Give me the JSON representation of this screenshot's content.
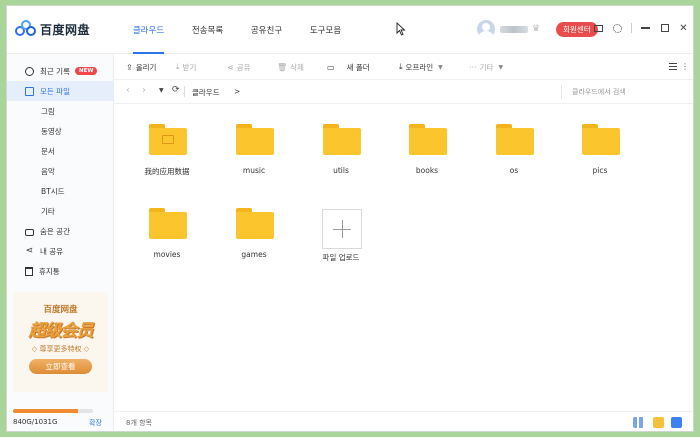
{
  "app": {
    "name": "百度网盘",
    "tabs": [
      "클라우드",
      "전송목록",
      "공유친구",
      "도구모음"
    ],
    "vip_label": "회원센터"
  },
  "sidebar": {
    "items": [
      {
        "label": "최근 기록",
        "icon": "clock-icon",
        "badge": "NEW"
      },
      {
        "label": "모든 파일",
        "icon": "file-icon"
      },
      {
        "label": "그림"
      },
      {
        "label": "동영상"
      },
      {
        "label": "문서"
      },
      {
        "label": "음악"
      },
      {
        "label": "BT시드"
      },
      {
        "label": "기타"
      },
      {
        "label": "숨은 공간",
        "icon": "lock-icon"
      },
      {
        "label": "내 공유",
        "icon": "share-icon"
      },
      {
        "label": "휴지통",
        "icon": "trash-icon"
      }
    ],
    "promo": {
      "brand": "百度网盘",
      "title": "超级会员",
      "subtitle": "◇ 尊享更多特权 ◇",
      "button": "立即查看"
    },
    "storage": {
      "used_text": "840G/1031G",
      "fraction": 0.815,
      "expand_label": "확장"
    }
  },
  "toolbar": {
    "upload": "올리기",
    "download": "받기",
    "share": "공유",
    "delete": "삭제",
    "new_folder": "새 폴더",
    "offline": "오프라인",
    "more": "기타"
  },
  "address": {
    "path": "클라우드",
    "separator": ">",
    "search_placeholder": "클라우드에서 검색"
  },
  "files": [
    {
      "name": "我的应用数据",
      "type": "special-folder"
    },
    {
      "name": "music",
      "type": "folder"
    },
    {
      "name": "utils",
      "type": "folder"
    },
    {
      "name": "books",
      "type": "folder"
    },
    {
      "name": "os",
      "type": "folder"
    },
    {
      "name": "pics",
      "type": "folder"
    },
    {
      "name": "movies",
      "type": "folder"
    },
    {
      "name": "games",
      "type": "folder"
    },
    {
      "name": "파일 업로드",
      "type": "upload"
    }
  ],
  "status": {
    "count": "8개 항목"
  },
  "colors": {
    "accent": "#2f74e8",
    "folder": "#fbc62d",
    "vip": "#e84c4c",
    "storage": "#f08b34"
  }
}
